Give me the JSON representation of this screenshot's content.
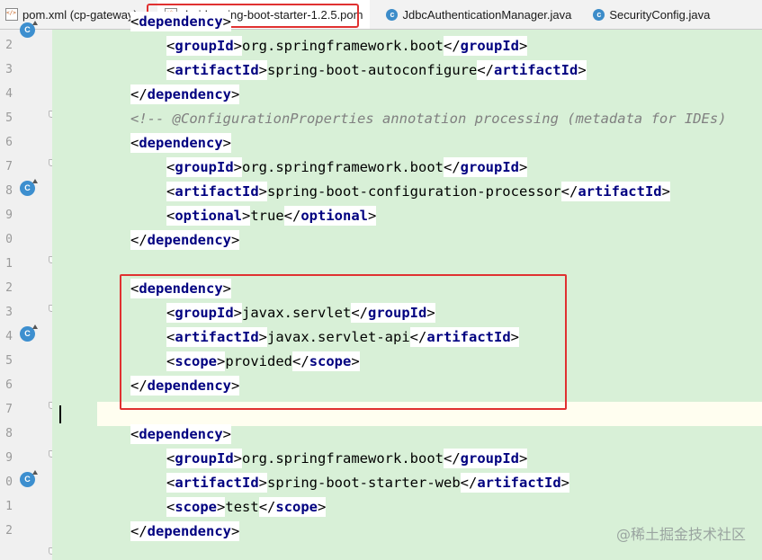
{
  "tabs": [
    {
      "label": "pom.xml (cp-gateway)",
      "icon": "xml-file-icon"
    },
    {
      "label": "druid-spring-boot-starter-1.2.5.pom",
      "icon": "xml-file-icon"
    },
    {
      "label": "JdbcAuthenticationManager.java",
      "icon": "java-class-icon"
    },
    {
      "label": "SecurityConfig.java",
      "icon": "java-class-icon"
    }
  ],
  "gutter": {
    "line_numbers": [
      "2",
      "3",
      "4",
      "5",
      "6",
      "7",
      "8",
      "9",
      "0",
      "1",
      "2",
      "3",
      "4",
      "5",
      "6",
      "7",
      "8",
      "9",
      "0",
      "1",
      "2"
    ],
    "icon_label": "C"
  },
  "code": {
    "lines": [
      {
        "indent": "",
        "tag": "",
        "text": ""
      },
      {
        "indent": "    ",
        "open": "groupId",
        "text": "org.springframework.boot",
        "close": "groupId"
      },
      {
        "indent": "    ",
        "open": "artifactId",
        "text": "spring-boot-autoconfigure",
        "close": "artifactId"
      },
      {
        "indent": "",
        "closeonly": "dependency"
      },
      {
        "indent": "",
        "comment": "<!-- @ConfigurationProperties annotation processing (metadata for IDEs)"
      },
      {
        "indent": "",
        "openonly": "dependency"
      },
      {
        "indent": "    ",
        "open": "groupId",
        "text": "org.springframework.boot",
        "close": "groupId"
      },
      {
        "indent": "    ",
        "open": "artifactId",
        "text": "spring-boot-configuration-processor",
        "close": "artifactId"
      },
      {
        "indent": "    ",
        "open": "optional",
        "text": "true",
        "close": "optional"
      },
      {
        "indent": "",
        "closeonly": "dependency"
      },
      {
        "indent": "",
        "blank": true
      },
      {
        "indent": "",
        "openonly": "dependency"
      },
      {
        "indent": "    ",
        "open": "groupId",
        "text": "javax.servlet",
        "close": "groupId"
      },
      {
        "indent": "    ",
        "open": "artifactId",
        "text": "javax.servlet-api",
        "close": "artifactId"
      },
      {
        "indent": "    ",
        "open": "scope",
        "text": "provided",
        "close": "scope"
      },
      {
        "indent": "",
        "closeonly": "dependency"
      },
      {
        "indent": "",
        "blank": true
      },
      {
        "indent": "",
        "openonly": "dependency"
      },
      {
        "indent": "    ",
        "open": "groupId",
        "text": "org.springframework.boot",
        "close": "groupId"
      },
      {
        "indent": "    ",
        "open": "artifactId",
        "text": "spring-boot-starter-web",
        "close": "artifactId"
      },
      {
        "indent": "    ",
        "open": "scope",
        "text": "test",
        "close": "scope"
      },
      {
        "indent": "",
        "closeonly": "dependency"
      }
    ],
    "first_partial": "dependency"
  },
  "watermark": "@稀土掘金技术社区",
  "colors": {
    "tag": "#000080",
    "comment": "#808080",
    "highlight": "#e03131",
    "green_bg": "#d8f0d7"
  }
}
